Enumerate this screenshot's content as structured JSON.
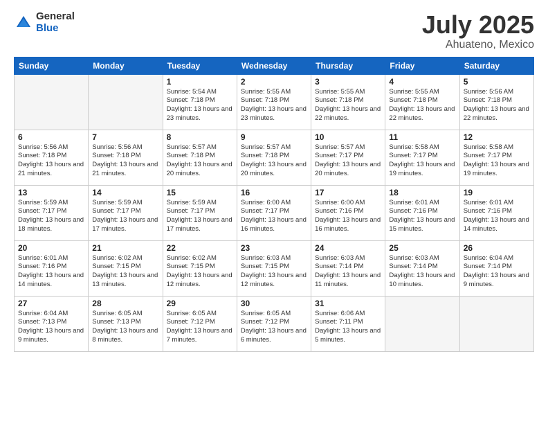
{
  "logo": {
    "general": "General",
    "blue": "Blue"
  },
  "title": "July 2025",
  "subtitle": "Ahuateno, Mexico",
  "headers": [
    "Sunday",
    "Monday",
    "Tuesday",
    "Wednesday",
    "Thursday",
    "Friday",
    "Saturday"
  ],
  "weeks": [
    [
      {
        "day": "",
        "info": ""
      },
      {
        "day": "",
        "info": ""
      },
      {
        "day": "1",
        "info": "Sunrise: 5:54 AM\nSunset: 7:18 PM\nDaylight: 13 hours\nand 23 minutes."
      },
      {
        "day": "2",
        "info": "Sunrise: 5:55 AM\nSunset: 7:18 PM\nDaylight: 13 hours\nand 23 minutes."
      },
      {
        "day": "3",
        "info": "Sunrise: 5:55 AM\nSunset: 7:18 PM\nDaylight: 13 hours\nand 22 minutes."
      },
      {
        "day": "4",
        "info": "Sunrise: 5:55 AM\nSunset: 7:18 PM\nDaylight: 13 hours\nand 22 minutes."
      },
      {
        "day": "5",
        "info": "Sunrise: 5:56 AM\nSunset: 7:18 PM\nDaylight: 13 hours\nand 22 minutes."
      }
    ],
    [
      {
        "day": "6",
        "info": "Sunrise: 5:56 AM\nSunset: 7:18 PM\nDaylight: 13 hours\nand 21 minutes."
      },
      {
        "day": "7",
        "info": "Sunrise: 5:56 AM\nSunset: 7:18 PM\nDaylight: 13 hours\nand 21 minutes."
      },
      {
        "day": "8",
        "info": "Sunrise: 5:57 AM\nSunset: 7:18 PM\nDaylight: 13 hours\nand 20 minutes."
      },
      {
        "day": "9",
        "info": "Sunrise: 5:57 AM\nSunset: 7:18 PM\nDaylight: 13 hours\nand 20 minutes."
      },
      {
        "day": "10",
        "info": "Sunrise: 5:57 AM\nSunset: 7:17 PM\nDaylight: 13 hours\nand 20 minutes."
      },
      {
        "day": "11",
        "info": "Sunrise: 5:58 AM\nSunset: 7:17 PM\nDaylight: 13 hours\nand 19 minutes."
      },
      {
        "day": "12",
        "info": "Sunrise: 5:58 AM\nSunset: 7:17 PM\nDaylight: 13 hours\nand 19 minutes."
      }
    ],
    [
      {
        "day": "13",
        "info": "Sunrise: 5:59 AM\nSunset: 7:17 PM\nDaylight: 13 hours\nand 18 minutes."
      },
      {
        "day": "14",
        "info": "Sunrise: 5:59 AM\nSunset: 7:17 PM\nDaylight: 13 hours\nand 17 minutes."
      },
      {
        "day": "15",
        "info": "Sunrise: 5:59 AM\nSunset: 7:17 PM\nDaylight: 13 hours\nand 17 minutes."
      },
      {
        "day": "16",
        "info": "Sunrise: 6:00 AM\nSunset: 7:17 PM\nDaylight: 13 hours\nand 16 minutes."
      },
      {
        "day": "17",
        "info": "Sunrise: 6:00 AM\nSunset: 7:16 PM\nDaylight: 13 hours\nand 16 minutes."
      },
      {
        "day": "18",
        "info": "Sunrise: 6:01 AM\nSunset: 7:16 PM\nDaylight: 13 hours\nand 15 minutes."
      },
      {
        "day": "19",
        "info": "Sunrise: 6:01 AM\nSunset: 7:16 PM\nDaylight: 13 hours\nand 14 minutes."
      }
    ],
    [
      {
        "day": "20",
        "info": "Sunrise: 6:01 AM\nSunset: 7:16 PM\nDaylight: 13 hours\nand 14 minutes."
      },
      {
        "day": "21",
        "info": "Sunrise: 6:02 AM\nSunset: 7:15 PM\nDaylight: 13 hours\nand 13 minutes."
      },
      {
        "day": "22",
        "info": "Sunrise: 6:02 AM\nSunset: 7:15 PM\nDaylight: 13 hours\nand 12 minutes."
      },
      {
        "day": "23",
        "info": "Sunrise: 6:03 AM\nSunset: 7:15 PM\nDaylight: 13 hours\nand 12 minutes."
      },
      {
        "day": "24",
        "info": "Sunrise: 6:03 AM\nSunset: 7:14 PM\nDaylight: 13 hours\nand 11 minutes."
      },
      {
        "day": "25",
        "info": "Sunrise: 6:03 AM\nSunset: 7:14 PM\nDaylight: 13 hours\nand 10 minutes."
      },
      {
        "day": "26",
        "info": "Sunrise: 6:04 AM\nSunset: 7:14 PM\nDaylight: 13 hours\nand 9 minutes."
      }
    ],
    [
      {
        "day": "27",
        "info": "Sunrise: 6:04 AM\nSunset: 7:13 PM\nDaylight: 13 hours\nand 9 minutes."
      },
      {
        "day": "28",
        "info": "Sunrise: 6:05 AM\nSunset: 7:13 PM\nDaylight: 13 hours\nand 8 minutes."
      },
      {
        "day": "29",
        "info": "Sunrise: 6:05 AM\nSunset: 7:12 PM\nDaylight: 13 hours\nand 7 minutes."
      },
      {
        "day": "30",
        "info": "Sunrise: 6:05 AM\nSunset: 7:12 PM\nDaylight: 13 hours\nand 6 minutes."
      },
      {
        "day": "31",
        "info": "Sunrise: 6:06 AM\nSunset: 7:11 PM\nDaylight: 13 hours\nand 5 minutes."
      },
      {
        "day": "",
        "info": ""
      },
      {
        "day": "",
        "info": ""
      }
    ]
  ]
}
